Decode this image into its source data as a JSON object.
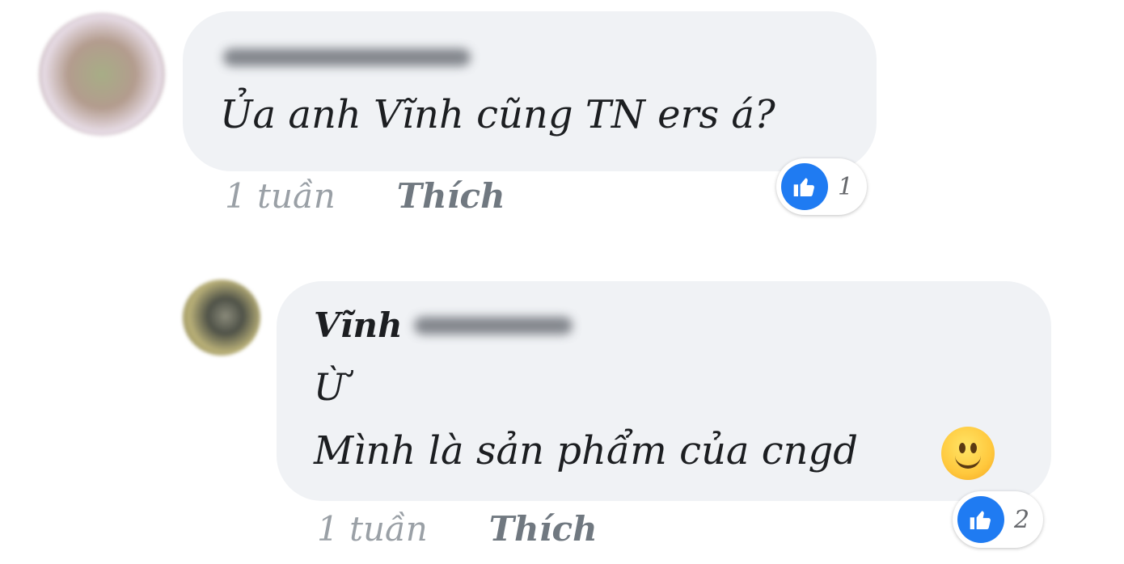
{
  "comments": [
    {
      "text": "Ủa anh Vĩnh cũng TN ers á?",
      "time": "1 tuần",
      "like_label": "Thích",
      "reaction_icon": "like-icon",
      "reaction_count": "1"
    },
    {
      "author": "Vĩnh",
      "line1": "Ừ",
      "line2": "Mình là sản phẩm của cngd",
      "emoji_icon": "smiling-face-emoji",
      "time": "1 tuần",
      "like_label": "Thích",
      "reaction_icon": "like-icon",
      "reaction_count": "2"
    }
  ],
  "colors": {
    "bubble": "#f0f2f5",
    "like_blue": "#1f7bf2",
    "meta_gray": "#9aa0a6"
  }
}
